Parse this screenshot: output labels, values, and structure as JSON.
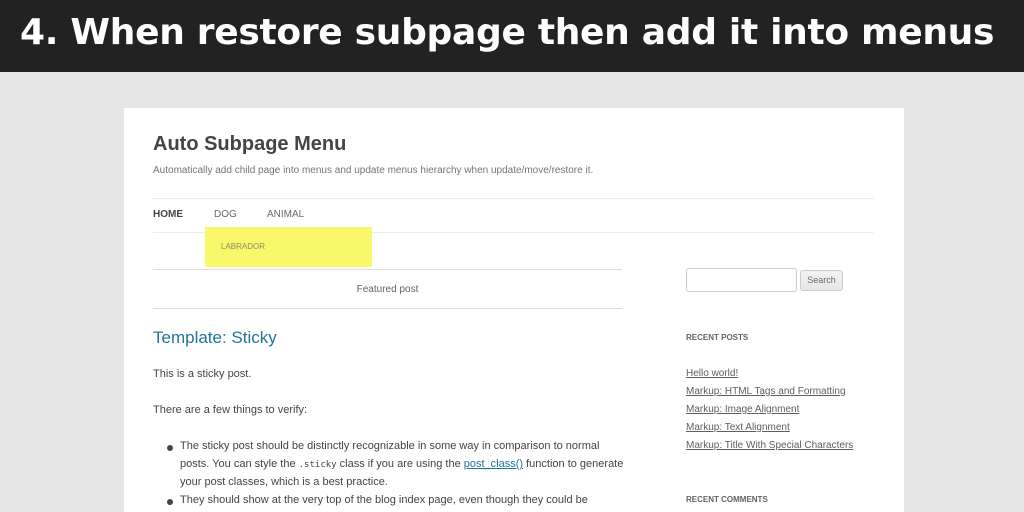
{
  "banner": {
    "title": "4. When restore subpage then add it into menus"
  },
  "site": {
    "title": "Auto Subpage Menu",
    "description": "Automatically add child page into menus and update menus hierarchy when update/move/restore it."
  },
  "nav": {
    "items": [
      {
        "label": "HOME"
      },
      {
        "label": "DOG"
      },
      {
        "label": "ANIMAL"
      }
    ],
    "submenu": [
      {
        "label": "LABRADOR"
      }
    ]
  },
  "main": {
    "featured_label": "Featured post",
    "post_title": "Template: Sticky",
    "paragraphs": [
      "This is a sticky post.",
      "There are a few things to verify:"
    ],
    "list": {
      "item1": {
        "line1": "The sticky post should be distinctly recognizable in some way in comparison to normal",
        "line2_a": "posts. You can style the ",
        "line2_code": ".sticky",
        "line2_b": " class if you are using the ",
        "line2_link": "post_class()",
        "line2_c": " function to generate",
        "line3": "your post classes, which is a best practice."
      },
      "item2": {
        "line1": "They should show at the very top of the blog index page, even though they could be"
      }
    }
  },
  "sidebar": {
    "search": {
      "placeholder": "",
      "button_label": "Search"
    },
    "recent_posts": {
      "title": "RECENT POSTS",
      "items": [
        "Hello world!",
        "Markup: HTML Tags and Formatting",
        "Markup: Image Alignment",
        "Markup: Text Alignment",
        "Markup: Title With Special Characters"
      ]
    },
    "recent_comments": {
      "title": "RECENT COMMENTS"
    }
  },
  "colors": {
    "banner_bg": "#222222",
    "highlight": "#f8f86a",
    "link": "#21759b"
  }
}
